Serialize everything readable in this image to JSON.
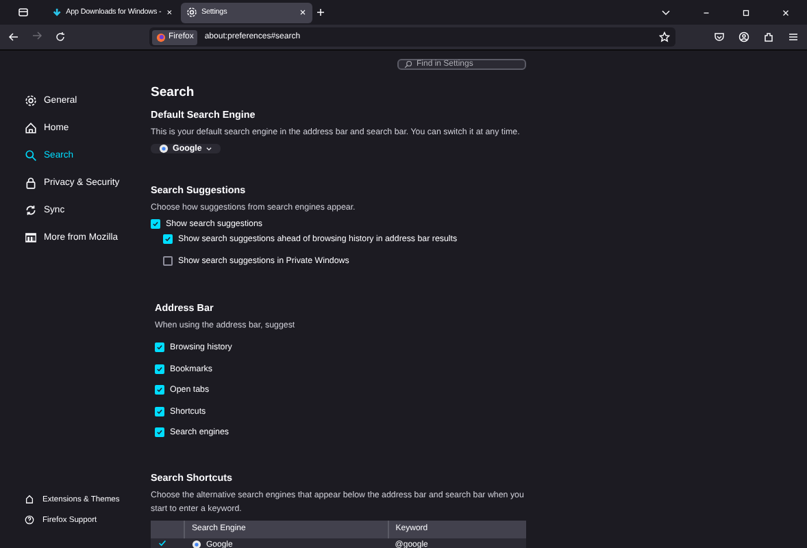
{
  "browser": {
    "tabs": [
      {
        "title": "App Downloads for Windows -",
        "selected": false
      },
      {
        "title": "Settings",
        "selected": true
      }
    ],
    "address": {
      "identity": "Firefox",
      "url": "about:preferences#search"
    }
  },
  "search_field": {
    "placeholder": "Find in Settings"
  },
  "sidebar": {
    "items": [
      {
        "label": "General",
        "selected": false
      },
      {
        "label": "Home",
        "selected": false
      },
      {
        "label": "Search",
        "selected": true
      },
      {
        "label": "Privacy & Security",
        "selected": false
      },
      {
        "label": "Sync",
        "selected": false
      },
      {
        "label": "More from Mozilla",
        "selected": false
      }
    ],
    "footer": [
      {
        "label": "Extensions & Themes"
      },
      {
        "label": "Firefox Support"
      }
    ]
  },
  "page": {
    "title": "Search",
    "default_engine": {
      "heading": "Default Search Engine",
      "description": "This is your default search engine in the address bar and search bar. You can switch it at any time.",
      "engine": "Google"
    },
    "suggestions": {
      "heading": "Search Suggestions",
      "description": "Choose how suggestions from search engines appear.",
      "options": [
        {
          "label": "Show search suggestions",
          "checked": true,
          "children": [
            {
              "label": "Show search suggestions ahead of browsing history in address bar results",
              "checked": true
            },
            {
              "label": "Show search suggestions in Private Windows",
              "checked": false
            }
          ]
        }
      ]
    },
    "address_bar": {
      "heading": "Address Bar",
      "description": "When using the address bar, suggest",
      "options": [
        {
          "label": "Browsing history",
          "checked": true
        },
        {
          "label": "Bookmarks",
          "checked": true
        },
        {
          "label": "Open tabs",
          "checked": true
        },
        {
          "label": "Shortcuts",
          "checked": true
        },
        {
          "label": "Search engines",
          "checked": true
        }
      ]
    },
    "shortcuts": {
      "heading": "Search Shortcuts",
      "description": "Choose the alternative search engines that appear below the address bar and search bar when you start to enter a keyword.",
      "columns": [
        "Search Engine",
        "Keyword"
      ],
      "rows": [
        {
          "checked": true,
          "engine": "Google",
          "keyword": "@google"
        }
      ]
    }
  }
}
